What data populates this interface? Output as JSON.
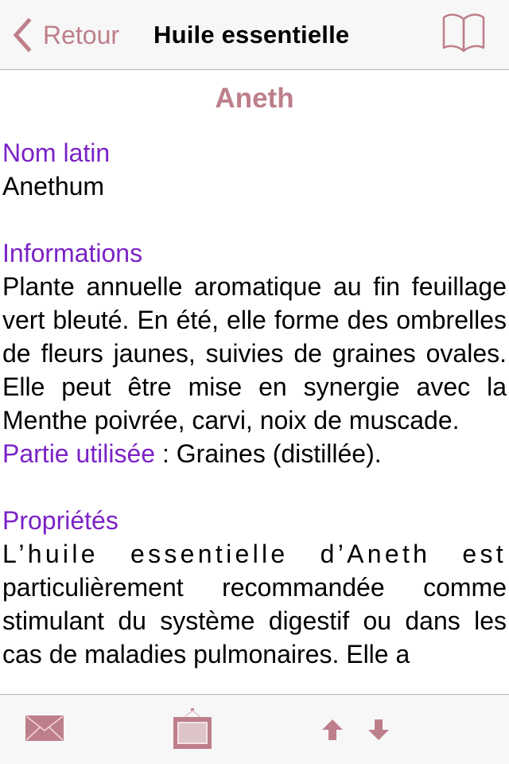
{
  "nav": {
    "back_label": "Retour",
    "title": "Huile essentielle",
    "back_icon": "chevron-left-icon",
    "right_icon": "book-icon"
  },
  "colors": {
    "accent": "#bd7f8a",
    "section_label": "#7b22c6",
    "text": "#000000",
    "bar_background": "#f7f7f7"
  },
  "article": {
    "title": "Aneth",
    "latin_name_label": "Nom latin",
    "latin_name": "Anethum",
    "info_label": "Informations",
    "info_text": "Plante annuelle aromatique au fin feuillage vert bleuté. En été, elle forme des ombrelles de fleurs jaunes, suivies de graines ovales. Elle peut être mise en synergie avec la Menthe poivrée, carvi, noix de muscade.",
    "part_used_label": "Partie utilisée",
    "part_used_separator": " : ",
    "part_used_value": "Graines (distillée).",
    "properties_label": "Propriétés",
    "properties_first_line": "L’huile essentielle d’Aneth est",
    "properties_text": "particulièrement recommandée comme stimulant du système digestif ou dans les cas de maladies pulmonaires. Elle a"
  },
  "toolbar": {
    "items": [
      {
        "icon": "mail-icon"
      },
      {
        "icon": "picture-frame-icon"
      },
      {
        "icon": "arrow-up-icon"
      },
      {
        "icon": "arrow-down-icon"
      }
    ]
  }
}
